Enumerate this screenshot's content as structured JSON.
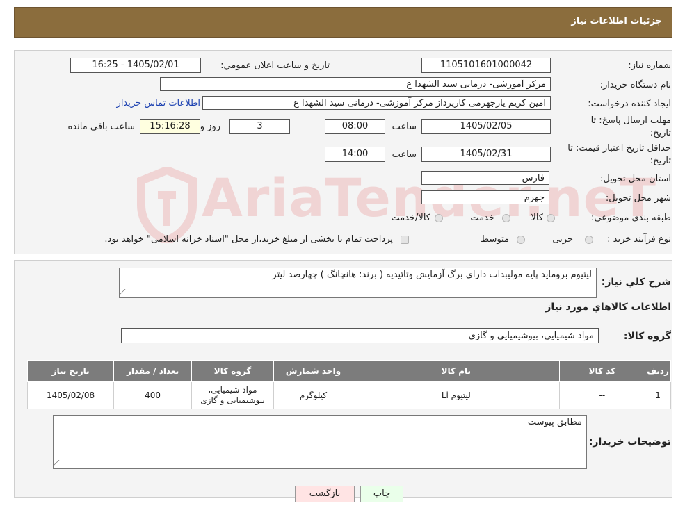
{
  "header": {
    "title": "جزئیات اطلاعات نیاز"
  },
  "fields": {
    "need_number_label": "شماره نیاز:",
    "need_number": "1105101601000042",
    "announce_label": "تاريخ و ساعت اعلان عمومي:",
    "announce_value": "1405/02/01 - 16:25",
    "buyer_org_label": "نام دستگاه خريدار:",
    "buyer_org": "مرکز آموزشی- درمانی سید الشهدا ع",
    "creator_label": "ایجاد کننده درخواست:",
    "creator": "امین کریم یارجهرمی کارپرداز مرکز آموزشی- درمانی سید الشهدا ع",
    "contact_link": "اطلاعات تماس خریدار",
    "deadline_label": "مهلت ارسال پاسخ: تا",
    "deadline_label2": "تاریخ:",
    "deadline_date": "1405/02/05",
    "time_label": "ساعت",
    "deadline_time": "08:00",
    "days": "3",
    "days_label": "روز و",
    "remaining": "15:16:28",
    "remaining_label": "ساعت باقي مانده",
    "validity_label": "حداقل تاریخ اعتبار قیمت: تا",
    "validity_label2": "تاریخ:",
    "validity_date": "1405/02/31",
    "validity_time_label": "ساعت",
    "validity_time": "14:00",
    "province_label": "استان محل تحویل:",
    "province": "فارس",
    "city_label": "شهر محل تحویل:",
    "city": "جهرم",
    "category_label": "طبقه بندی موضوعی:",
    "category_options": [
      "کالا",
      "خدمت",
      "کالا/خدمت"
    ],
    "process_label": "نوع فرآیند خرید :",
    "process_options": [
      "جزیی",
      "متوسط"
    ],
    "payment_note": "پرداخت تمام یا بخشی از مبلغ خرید،از محل \"اسناد خزانه اسلامی\" خواهد بود."
  },
  "description": {
    "label": "شرح کلي نياز:",
    "text": "لیتیوم برومايد پايه موليبدات دارای برگ آزمایش وتائیدیه  ( برند: هانچانگ ) چهارصد لیتر"
  },
  "goods_info": {
    "title": "اطلاعات کالاهاي مورد نياز",
    "group_label": "گروه کالا:",
    "group_value": "مواد شیمیایی، بیوشیمیایی و  گازی"
  },
  "table": {
    "headers": [
      "رديف",
      "کد کالا",
      "نام کالا",
      "واحد شمارش",
      "گروه کالا",
      "تعداد / مقدار",
      "تاريخ نياز"
    ],
    "rows": [
      {
        "row": "1",
        "code": "--",
        "name": "لیتیوم Li",
        "unit": "کیلوگرم",
        "group_line1": "مواد شیمیایی،",
        "group_line2": "بیوشیمیایی و گازی",
        "qty": "400",
        "date": "1405/02/08"
      }
    ]
  },
  "buyer_notes": {
    "label": "توضیحات خریدار:",
    "text": "مطابق پیوست"
  },
  "buttons": {
    "print": "چاپ",
    "back": "بازگشت"
  },
  "watermark": {
    "text": "AriaTender.neT"
  },
  "colors": {
    "header_bg": "#8b6d3d",
    "table_header_bg": "#7c7c7c",
    "print_bg": "#eaffea",
    "back_bg": "#ffe4e4",
    "link": "#1a3fb0"
  }
}
